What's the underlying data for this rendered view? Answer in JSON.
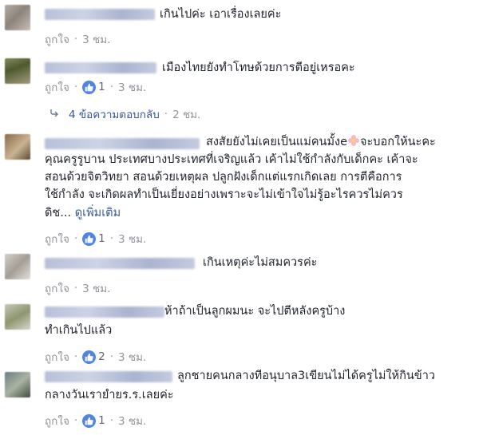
{
  "comments": [
    {
      "text_lines": [
        "เกินไปค่ะ เอาเรื่องเลยค่ะ"
      ],
      "like_label": "ถูกใจ",
      "time": "3 ชม.",
      "likes": ""
    },
    {
      "text_lines": [
        "เมืองไทยยังทำโทษด้วยการตีอยู่เหรอคะ"
      ],
      "like_label": "ถูกใจ",
      "likes": "1",
      "time": "3 ชม.",
      "replies_label": "4 ข้อความตอบกลับ",
      "replies_time": "2 ชม."
    },
    {
      "text_lines": [
        "สงสัยยังไม่เคยเป็นแม่คนมั้งe",
        "จะบอกให้นะคะ",
        "คุณครูรูบาน ประเทศบางประเทศที่เจริญแล้ว เค้าไม่ใช้กำลังกับเด็กคะ เค้าจะ",
        "สอนด้วยจิตวิทยา สอนด้วยเหตุผล ปลูกฝังเด็กแต่แรกเกิดเลย การตีคือการ",
        "ใช้กำลัง จะเกิดผลทำเป็นเยี่ยงอย่างเพราะจะไม่เข้าใจไม่รู้อะไรควรไม่ควร",
        "ดิช..."
      ],
      "see_more": "ดูเพิ่มเติม",
      "like_label": "ถูกใจ",
      "likes": "1",
      "time": "3 ชม."
    },
    {
      "text_lines": [
        "เกินเหตุค่ะไม่สมควรค่ะ"
      ],
      "like_label": "ถูกใจ",
      "time": "3 ชม."
    },
    {
      "text_lines": [
        "ห้าถ้าเป็นลูกผมนะ จะไปตีหลังครูบ้าง",
        "ทำเกินไปแล้ว"
      ],
      "like_label": "ถูกใจ",
      "likes": "2",
      "time": "3 ชม."
    },
    {
      "text_lines": [
        "ลูกชายคนกลางทีอนุบาล3เขียนไม่ได้ครูไม่ให้กินข้าว",
        "กลางวันเรายํายร.ร.เลยค่ะ"
      ],
      "like_label": "ถูกใจ",
      "likes": "1",
      "time": "3 ชม."
    }
  ],
  "colors": {
    "link": "#365899",
    "meta": "#90949c",
    "like_badge": "#4f83e6",
    "text": "#1d2129"
  },
  "icons": {
    "like": "thumbs-up-icon",
    "reply_arrow": "reply-arrow-icon",
    "emoji": "flower-emoji-icon"
  }
}
